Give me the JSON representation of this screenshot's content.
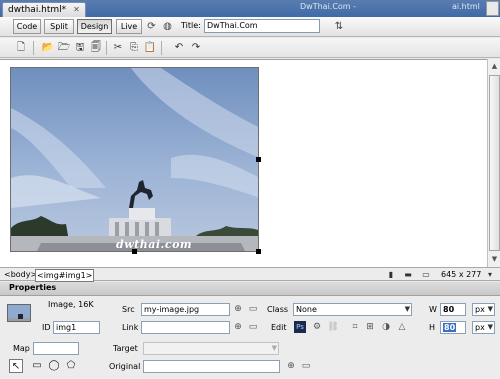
{
  "window": {
    "doc_tab": "dwthai.html*",
    "center_title": "DwThai.Com -",
    "right_title": "ai.html"
  },
  "doc_toolbar": {
    "views": [
      "Code",
      "Split",
      "Design",
      "Live"
    ],
    "active_view": "Design",
    "title_label": "Title:",
    "title_value": "DwThai.Com"
  },
  "design": {
    "image_watermark": "dwthai.com"
  },
  "status": {
    "tags": [
      "<body>",
      "<img#img1>"
    ],
    "window_size": "645 x 277"
  },
  "properties": {
    "header": "Properties",
    "image_info": "Image, 16K",
    "id_label": "ID",
    "id_value": "img1",
    "src_label": "Src",
    "src_value": "my-image.jpg",
    "link_label": "Link",
    "link_value": "",
    "class_label": "Class",
    "class_value": "None",
    "edit_label": "Edit",
    "w_label": "W",
    "w_value": "80",
    "h_label": "H",
    "h_value": "80",
    "unit_w": "px",
    "unit_h": "px",
    "map_label": "Map",
    "map_value": "",
    "target_label": "Target",
    "target_value": "",
    "original_label": "Original",
    "original_value": ""
  },
  "colors": {
    "titlebar": "#4a72ad",
    "sky": "#8aa6cc",
    "accent_selection": "#3b6fc7"
  }
}
